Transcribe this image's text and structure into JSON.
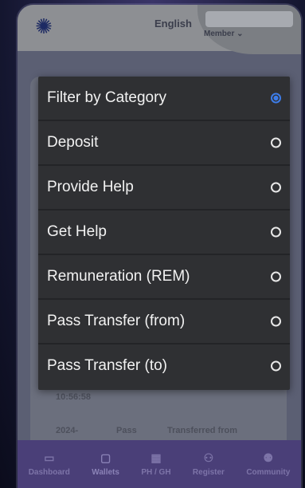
{
  "header": {
    "language": "English",
    "account_menu": "Member"
  },
  "background_rows": [
    {
      "text": "10:56:58"
    },
    {
      "col1": "2024-",
      "col2": "Pass",
      "col3": "Transferred from"
    }
  ],
  "filter": {
    "options": [
      {
        "label": "Filter by Category",
        "selected": true
      },
      {
        "label": "Deposit",
        "selected": false
      },
      {
        "label": "Provide Help",
        "selected": false
      },
      {
        "label": "Get Help",
        "selected": false
      },
      {
        "label": "Remuneration (REM)",
        "selected": false
      },
      {
        "label": "Pass Transfer (from)",
        "selected": false
      },
      {
        "label": "Pass Transfer (to)",
        "selected": false
      }
    ]
  },
  "bottom_nav": {
    "items": [
      {
        "label": "Dashboard",
        "icon": "dashboard-icon"
      },
      {
        "label": "Wallets",
        "icon": "wallet-icon"
      },
      {
        "label": "PH / GH",
        "icon": "ph-gh-icon"
      },
      {
        "label": "Register",
        "icon": "register-icon"
      },
      {
        "label": "Community",
        "icon": "community-icon"
      }
    ]
  },
  "colors": {
    "accent": "#3d7ce8",
    "modal_bg": "#2f3033",
    "nav_bg": "#4a3f78"
  }
}
